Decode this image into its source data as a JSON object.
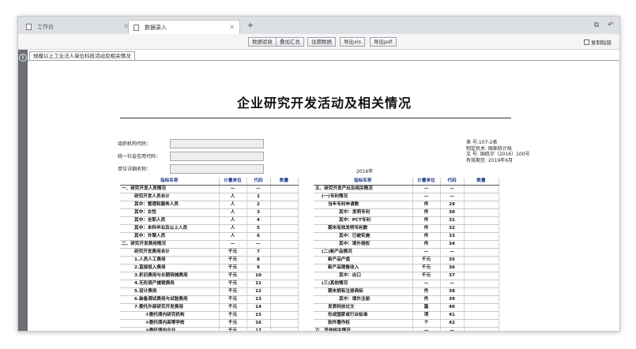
{
  "browser": {
    "tabs": [
      {
        "label": "工作台"
      },
      {
        "label": "数据录入"
      }
    ],
    "new_tab": "+",
    "window_icons": [
      "restore-icon",
      "back-icon"
    ]
  },
  "toolbar": {
    "buttons": [
      "数据验收",
      "叠加汇总",
      "往期数据",
      "导出xls",
      "导出pdf"
    ],
    "copy_link": "复制贴链"
  },
  "form_tab": "规模以上工业法人单位科技活动及相关情况",
  "doc": {
    "title": "企业研究开发活动及相关情况",
    "fields": [
      "组织机构代码：",
      "统一社会信用代码：",
      "单位详细名称："
    ],
    "year": "2016年",
    "meta": [
      "表    号:107-2表",
      "制定机关:  国家统计局",
      "文    号: 国统字（2016）100号",
      "有效期至: 2019年6月"
    ]
  },
  "table_headers": [
    "指标名称",
    "计量单位",
    "代码",
    "数量"
  ],
  "left_rows": [
    [
      "一、研究开发人员情况",
      "—",
      "—",
      "",
      "l"
    ],
    [
      "研究开发人员合计",
      "人",
      "1",
      "",
      "i1"
    ],
    [
      "其中：管理和服务人员",
      "人",
      "2",
      "",
      "i1"
    ],
    [
      "其中：女性",
      "人",
      "3",
      "",
      "i1"
    ],
    [
      "其中：全职人员",
      "人",
      "4",
      "",
      "i1"
    ],
    [
      "其中：本科毕业及以上人员",
      "人",
      "5",
      "",
      "i1"
    ],
    [
      "其中：外聘人员",
      "人",
      "6",
      "",
      "i1"
    ],
    [
      "二、研究开发费用情况",
      "—",
      "—",
      "",
      "l"
    ],
    [
      "研究开发费用合计",
      "千元",
      "7",
      "",
      "i1"
    ],
    [
      "1.人员人工费用",
      "千元",
      "8",
      "",
      "i1"
    ],
    [
      "2.直接投入费用",
      "千元",
      "9",
      "",
      "i1"
    ],
    [
      "3.折旧费用与长期待摊费用",
      "千元",
      "10",
      "",
      "i1"
    ],
    [
      "4.无形资产摊销费用",
      "千元",
      "11",
      "",
      "i1"
    ],
    [
      "5.设计费用",
      "千元",
      "12",
      "",
      "i1"
    ],
    [
      "6.装备调试费用与试验费用",
      "千元",
      "13",
      "",
      "i1"
    ],
    [
      "7.委托外部研究开发费用",
      "千元",
      "14",
      "",
      "i1"
    ],
    [
      "①委托境内研究机构",
      "千元",
      "15",
      "",
      "i2"
    ],
    [
      "②委托境内高等学校",
      "千元",
      "16",
      "",
      "i2"
    ],
    [
      "③委托境内企业",
      "千元",
      "17",
      "",
      "i2"
    ]
  ],
  "right_rows": [
    [
      "五、研究开发产出及相关情况",
      "—",
      "—",
      "",
      "l"
    ],
    [
      "(一)专利情况",
      "—",
      "—",
      "",
      "i0"
    ],
    [
      "当年专利申请数",
      "件",
      "29",
      "",
      "i1"
    ],
    [
      "其中：发明专利",
      "件",
      "30",
      "",
      "i2"
    ],
    [
      "其中：PCT专利",
      "件",
      "31",
      "",
      "i2"
    ],
    [
      "期末有效发明专利数",
      "件",
      "32",
      "",
      "i1"
    ],
    [
      "其中：已被实施",
      "件",
      "33",
      "",
      "i2"
    ],
    [
      "其中：境外授权",
      "件",
      "34",
      "",
      "i2"
    ],
    [
      "(二)新产品情况",
      "—",
      "—",
      "",
      "i0"
    ],
    [
      "新产品产值",
      "千元",
      "35",
      "",
      "i1"
    ],
    [
      "新产品销售收入",
      "千元",
      "36",
      "",
      "i1"
    ],
    [
      "其中：出口",
      "千元",
      "37",
      "",
      "i2"
    ],
    [
      "(三)其他情况",
      "—",
      "—",
      "",
      "i0"
    ],
    [
      "期末拥有注册商标",
      "件",
      "38",
      "",
      "i1"
    ],
    [
      "其中：境外注册",
      "件",
      "39",
      "",
      "i2"
    ],
    [
      "发表科技论文",
      "篇",
      "40",
      "",
      "i1"
    ],
    [
      "形成国家或行业标准",
      "项",
      "41",
      "",
      "i1"
    ],
    [
      "软件著作权",
      "个",
      "42",
      "",
      "i1"
    ],
    [
      "六、其他相关情况",
      "—",
      "—",
      "",
      "l"
    ]
  ]
}
